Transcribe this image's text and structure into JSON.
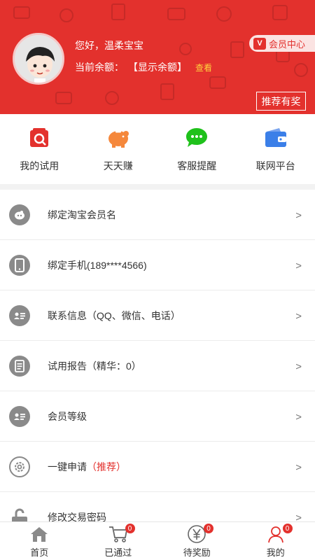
{
  "header": {
    "greeting": "您好，温柔宝宝",
    "balance_label": "当前余额：",
    "balance_value": "【显示余额】",
    "view_link": "查看",
    "member_badge": "V",
    "member_center": "会员中心",
    "recommend": "推荐有奖"
  },
  "quick": [
    {
      "label": "我的试用",
      "icon": "trial-icon",
      "color": "#e3312d"
    },
    {
      "label": "天天赚",
      "icon": "piggy-bank-icon",
      "color": "#f5883c"
    },
    {
      "label": "客服提醒",
      "icon": "chat-icon",
      "color": "#1fc11b"
    },
    {
      "label": "联网平台",
      "icon": "wallet-icon",
      "color": "#3b7fe8"
    }
  ],
  "menu": [
    {
      "label": "绑定淘宝会员名",
      "highlight": "",
      "icon": "taobao-icon"
    },
    {
      "label": "绑定手机(189****4566)",
      "highlight": "",
      "icon": "phone-icon"
    },
    {
      "label": "联系信息（QQ、微信、电话）",
      "highlight": "",
      "icon": "contact-card-icon"
    },
    {
      "label": "试用报告（精华：0）",
      "highlight": "",
      "icon": "report-icon"
    },
    {
      "label": "会员等级",
      "highlight": "",
      "icon": "member-card-icon"
    },
    {
      "label": "一键申请",
      "highlight": "（推荐）",
      "icon": "gear-icon"
    },
    {
      "label": "修改交易密码",
      "highlight": "",
      "icon": "unlock-icon"
    }
  ],
  "arrow": ">",
  "tabs": [
    {
      "label": "首页",
      "badge": "",
      "icon": "home-icon"
    },
    {
      "label": "已通过",
      "badge": "0",
      "icon": "cart-icon"
    },
    {
      "label": "待奖励",
      "badge": "0",
      "icon": "yen-icon"
    },
    {
      "label": "我的",
      "badge": "0",
      "icon": "user-icon"
    }
  ],
  "colors": {
    "accent": "#e3312d",
    "highlight_yellow": "#ffd33d"
  }
}
